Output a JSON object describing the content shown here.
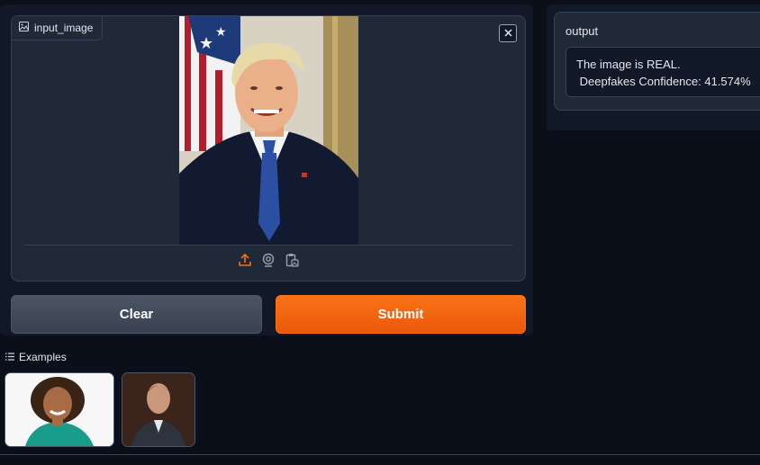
{
  "input_block": {
    "label": "input_image"
  },
  "buttons": {
    "clear": "Clear",
    "submit": "Submit"
  },
  "output_block": {
    "label": "output",
    "line1": "The image is REAL.",
    "line2": " Deepfakes Confidence: 41.574%"
  },
  "examples": {
    "label": "Examples"
  },
  "colors": {
    "background": "#0b0f19",
    "panel": "#111827",
    "accent": "#f97316",
    "upload_icon": "#f97316"
  },
  "icons": [
    "image-icon",
    "close-icon",
    "upload-icon",
    "webcam-icon",
    "clipboard-icon",
    "list-icon"
  ]
}
